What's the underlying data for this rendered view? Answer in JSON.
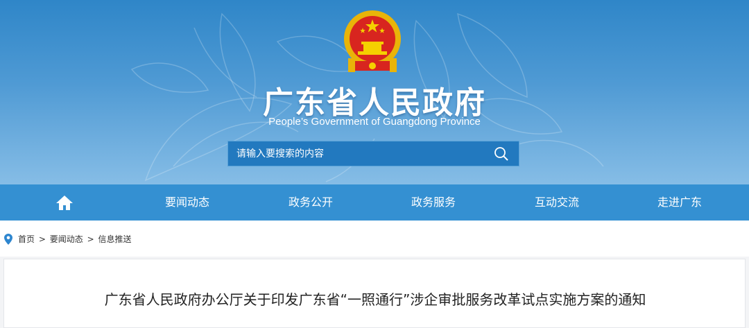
{
  "header": {
    "title_cn": "广东省人民政府",
    "title_en": "People’s Government of Guangdong Province",
    "emblem_icon": "national-emblem-icon"
  },
  "search": {
    "placeholder": "请输入要搜索的内容",
    "button_icon": "search-icon"
  },
  "nav": {
    "home_icon": "home-icon",
    "items": [
      {
        "label": "要闻动态"
      },
      {
        "label": "政务公开"
      },
      {
        "label": "政务服务"
      },
      {
        "label": "互动交流"
      },
      {
        "label": "走进广东"
      }
    ]
  },
  "breadcrumb": {
    "icon": "location-pin-icon",
    "items": [
      "首页",
      "要闻动态",
      "信息推送"
    ],
    "separator": ">"
  },
  "article": {
    "title": "广东省人民政府办公厅关于印发广东省“一照通行”涉企审批服务改革试点实施方案的通知"
  },
  "colors": {
    "nav_bg": "#3490d2",
    "header_top": "#2f86c8",
    "accent_red": "#d8251f",
    "gold": "#f5c400"
  }
}
